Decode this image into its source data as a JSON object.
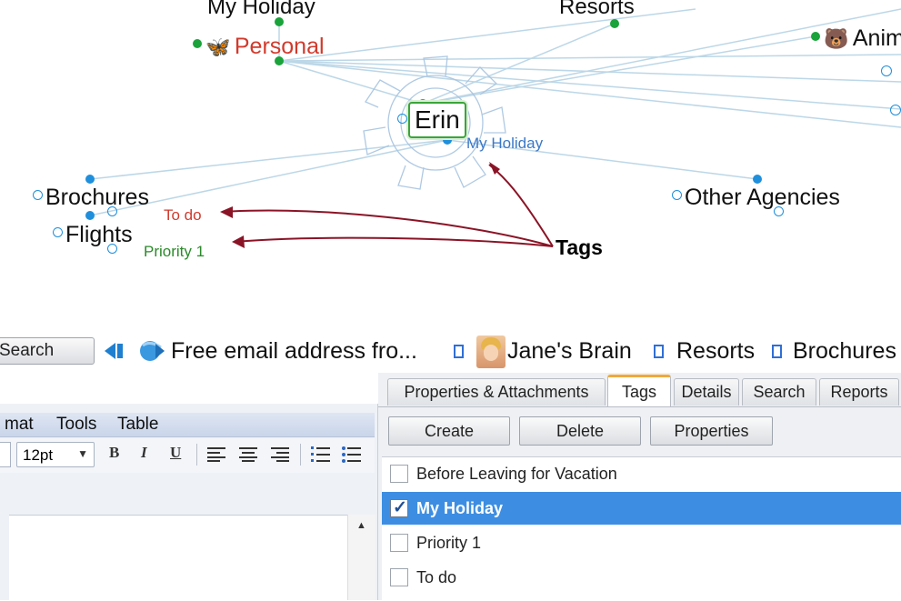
{
  "graph": {
    "nodes": {
      "my_holiday_top": "My Holiday",
      "resorts_top": "Resorts",
      "personal": "Personal",
      "animals_partial": "Anim",
      "central": "Erin",
      "central_tag": "My Holiday",
      "brochures": "Brochures",
      "flights": "Flights",
      "other_agencies": "Other Agencies"
    },
    "tag_notes": {
      "todo": "To do",
      "priority": "Priority 1"
    },
    "annotation": "Tags",
    "colors": {
      "link": "#b9d6e6",
      "node_dot_blue": "#1f8fdc",
      "node_dot_green": "#1aa33a",
      "personal": "#d23a2c",
      "todo": "#d23a2c",
      "priority": "#2a8a2a",
      "central_tag": "#3a78c7",
      "arrow": "#8a1426"
    }
  },
  "pinbar": {
    "search_button": "Search",
    "items": [
      "Free email address fro...",
      "Jane's Brain",
      "Resorts",
      "Brochures"
    ]
  },
  "editor": {
    "menus": [
      "mat",
      "Tools",
      "Table"
    ],
    "font_size": "12pt",
    "format_buttons": [
      "B",
      "I",
      "U"
    ]
  },
  "tags_panel": {
    "tabs": [
      "Properties & Attachments",
      "Tags",
      "Details",
      "Search",
      "Reports"
    ],
    "active_tab": "Tags",
    "buttons": [
      "Create",
      "Delete",
      "Properties"
    ],
    "tags": [
      {
        "label": "Before Leaving for Vacation",
        "checked": false,
        "selected": false
      },
      {
        "label": "My Holiday",
        "checked": true,
        "selected": true
      },
      {
        "label": "Priority 1",
        "checked": false,
        "selected": false
      },
      {
        "label": "To do",
        "checked": false,
        "selected": false
      }
    ],
    "colors": {
      "selection": "#3d8ee2",
      "active_tab_accent": "#f0a93a"
    }
  }
}
